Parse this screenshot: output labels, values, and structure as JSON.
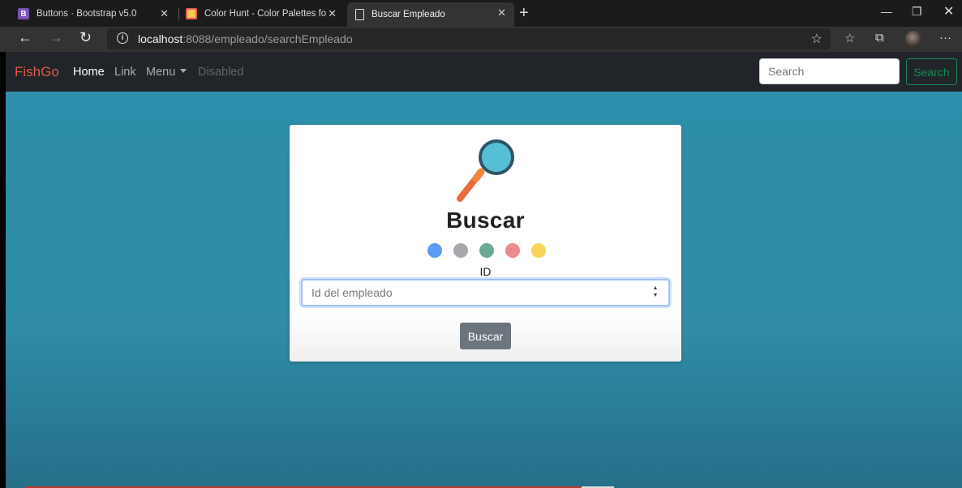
{
  "browser": {
    "tabs": [
      {
        "label": "Buttons · Bootstrap v5.0",
        "icon": "bootstrap-icon",
        "icon_color": "#7952b3",
        "active": false
      },
      {
        "label": "Color Hunt - Color Palettes for D",
        "icon": "colorhunt-icon",
        "icon_color": "#f2c94c",
        "active": false
      },
      {
        "label": "Buscar Empleado",
        "icon": "page-icon",
        "active": true
      }
    ],
    "address": {
      "host": "localhost",
      "path": ":8088/empleado/searchEmpleado"
    }
  },
  "navbar": {
    "brand": "FishGo",
    "brand_color": "#e05a45",
    "links": [
      {
        "label": "Home",
        "state": "active"
      },
      {
        "label": "Link",
        "state": "normal"
      },
      {
        "label": "Menu",
        "state": "dropdown"
      },
      {
        "label": "Disabled",
        "state": "disabled"
      }
    ],
    "search_placeholder": "Search",
    "search_button": "Search",
    "search_button_color": "#198754"
  },
  "card": {
    "title": "Buscar",
    "dot_colors": [
      "#5b9cf2",
      "#a7a9ac",
      "#6aab93",
      "#ec8a8c",
      "#f7d35a"
    ],
    "id_label": "ID",
    "input_placeholder": "Id del empleado",
    "submit_label": "Buscar",
    "submit_color": "#6c757d"
  },
  "colors": {
    "background": "#2d8fab"
  }
}
